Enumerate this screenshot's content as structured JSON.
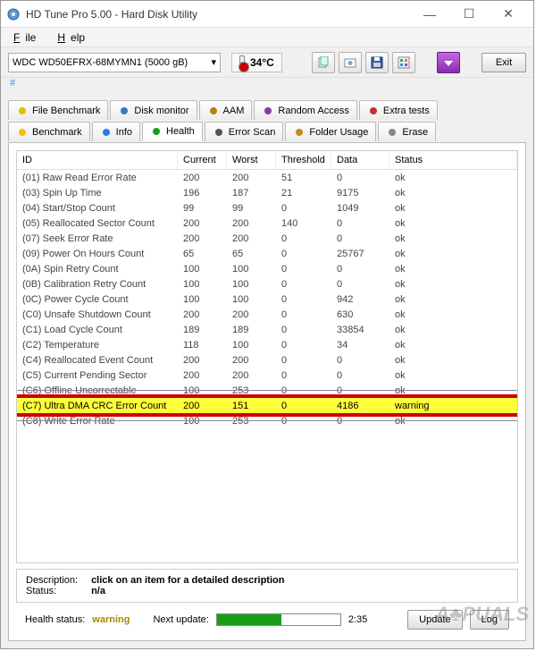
{
  "window": {
    "title": "HD Tune Pro 5.00 - Hard Disk Utility",
    "min_icon": "—",
    "max_icon": "☐",
    "close_icon": "✕"
  },
  "menu": {
    "file": "File",
    "help": "Help"
  },
  "toolbar": {
    "drive": "WDC WD50EFRX-68MYMN1 (5000 gB)",
    "temp": "34°C",
    "exit_label": "Exit"
  },
  "breadcrumb": "#",
  "tabs_row1": [
    {
      "id": "file-benchmark",
      "label": "File Benchmark",
      "color": "#e0c000"
    },
    {
      "id": "disk-monitor",
      "label": "Disk monitor",
      "color": "#3878c8"
    },
    {
      "id": "aam",
      "label": "AAM",
      "color": "#b38410"
    },
    {
      "id": "random-access",
      "label": "Random Access",
      "color": "#8040a0"
    },
    {
      "id": "extra-tests",
      "label": "Extra tests",
      "color": "#c03030"
    }
  ],
  "tabs_row2": [
    {
      "id": "benchmark",
      "label": "Benchmark",
      "color": "#f0c010"
    },
    {
      "id": "info",
      "label": "Info",
      "color": "#2a7be4"
    },
    {
      "id": "health",
      "label": "Health",
      "color": "#14a014",
      "selected": true
    },
    {
      "id": "error-scan",
      "label": "Error Scan",
      "color": "#555"
    },
    {
      "id": "folder-usage",
      "label": "Folder Usage",
      "color": "#c88a20"
    },
    {
      "id": "erase",
      "label": "Erase",
      "color": "#888"
    }
  ],
  "columns": {
    "id": "ID",
    "current": "Current",
    "worst": "Worst",
    "threshold": "Threshold",
    "data": "Data",
    "status": "Status"
  },
  "rows": [
    {
      "id": "(01) Raw Read Error Rate",
      "cur": "200",
      "wor": "200",
      "thr": "51",
      "dat": "0",
      "sta": "ok"
    },
    {
      "id": "(03) Spin Up Time",
      "cur": "196",
      "wor": "187",
      "thr": "21",
      "dat": "9175",
      "sta": "ok"
    },
    {
      "id": "(04) Start/Stop Count",
      "cur": "99",
      "wor": "99",
      "thr": "0",
      "dat": "1049",
      "sta": "ok"
    },
    {
      "id": "(05) Reallocated Sector Count",
      "cur": "200",
      "wor": "200",
      "thr": "140",
      "dat": "0",
      "sta": "ok"
    },
    {
      "id": "(07) Seek Error Rate",
      "cur": "200",
      "wor": "200",
      "thr": "0",
      "dat": "0",
      "sta": "ok"
    },
    {
      "id": "(09) Power On Hours Count",
      "cur": "65",
      "wor": "65",
      "thr": "0",
      "dat": "25767",
      "sta": "ok"
    },
    {
      "id": "(0A) Spin Retry Count",
      "cur": "100",
      "wor": "100",
      "thr": "0",
      "dat": "0",
      "sta": "ok"
    },
    {
      "id": "(0B) Calibration Retry Count",
      "cur": "100",
      "wor": "100",
      "thr": "0",
      "dat": "0",
      "sta": "ok"
    },
    {
      "id": "(0C) Power Cycle Count",
      "cur": "100",
      "wor": "100",
      "thr": "0",
      "dat": "942",
      "sta": "ok"
    },
    {
      "id": "(C0) Unsafe Shutdown Count",
      "cur": "200",
      "wor": "200",
      "thr": "0",
      "dat": "630",
      "sta": "ok"
    },
    {
      "id": "(C1) Load Cycle Count",
      "cur": "189",
      "wor": "189",
      "thr": "0",
      "dat": "33854",
      "sta": "ok"
    },
    {
      "id": "(C2) Temperature",
      "cur": "118",
      "wor": "100",
      "thr": "0",
      "dat": "34",
      "sta": "ok"
    },
    {
      "id": "(C4) Reallocated Event Count",
      "cur": "200",
      "wor": "200",
      "thr": "0",
      "dat": "0",
      "sta": "ok"
    },
    {
      "id": "(C5) Current Pending Sector",
      "cur": "200",
      "wor": "200",
      "thr": "0",
      "dat": "0",
      "sta": "ok"
    },
    {
      "id": "(C6) Offline Uncorrectable",
      "cur": "100",
      "wor": "253",
      "thr": "0",
      "dat": "0",
      "sta": "ok",
      "strike": true
    },
    {
      "id": "(C7) Ultra DMA CRC Error Count",
      "cur": "200",
      "wor": "151",
      "thr": "0",
      "dat": "4186",
      "sta": "warning",
      "hl": true
    },
    {
      "id": "(C8) Write Error Rate",
      "cur": "100",
      "wor": "253",
      "thr": "0",
      "dat": "0",
      "sta": "ok",
      "strike": true
    }
  ],
  "description_box": {
    "desc_label": "Description:",
    "desc_value": "click on an item for a detailed description",
    "status_label": "Status:",
    "status_value": "n/a"
  },
  "footer": {
    "health_label": "Health status:",
    "health_value": "warning",
    "next_update_label": "Next update:",
    "countdown": "2:35",
    "update_btn": "Update",
    "log_btn": "Log",
    "progress_pct": 52
  },
  "watermark": "A♣PUALS"
}
